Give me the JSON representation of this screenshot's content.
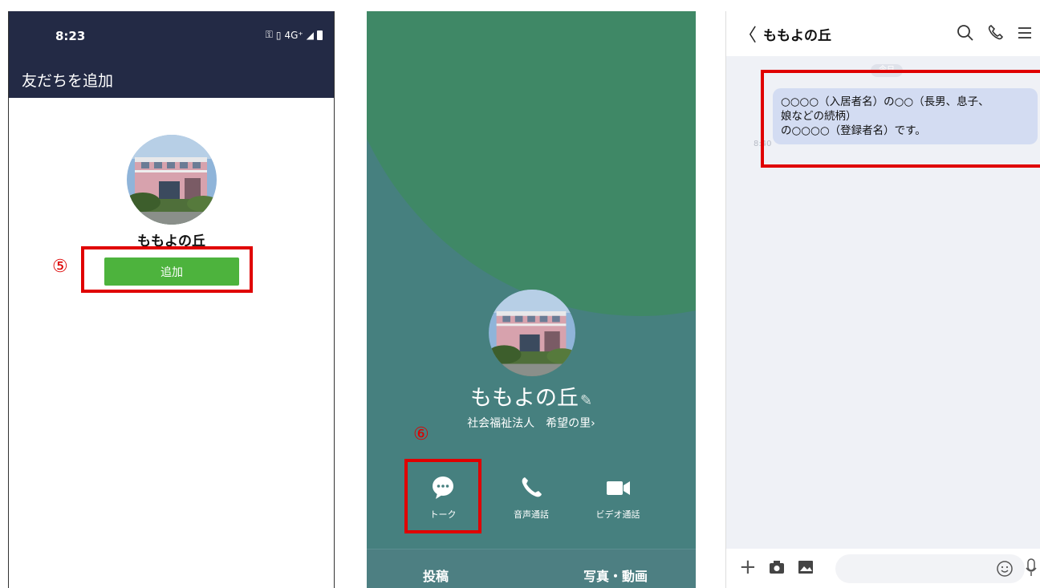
{
  "panel1": {
    "status": {
      "time": "8:23",
      "network": "4G⁺"
    },
    "header_title": "友だちを追加",
    "account_name": "ももよの丘",
    "step_marker": "⑤",
    "add_button": "追加"
  },
  "panel2": {
    "account_name": "ももよの丘",
    "subtitle": "社会福祉法人　希望の里›",
    "step_marker": "⑥",
    "actions": {
      "talk": "トーク",
      "voice_call": "音声通話",
      "video_call": "ビデオ通話"
    },
    "bottom_tabs": {
      "posts": "投稿",
      "photos_videos": "写真・動画"
    }
  },
  "panel3": {
    "title": "ももよの丘",
    "date_label": "今日",
    "message_time": "8:40",
    "message_lines": [
      "○○○○（入居者名）の○○（長男、息子、",
      "娘などの続柄）",
      "の○○○○（登録者名）です。"
    ]
  },
  "colors": {
    "header_navy": "#232a45",
    "add_green": "#4db33d",
    "highlight_red": "#e00000",
    "profile_teal": "#46807f",
    "bubble_blue": "#d3dcf2"
  }
}
